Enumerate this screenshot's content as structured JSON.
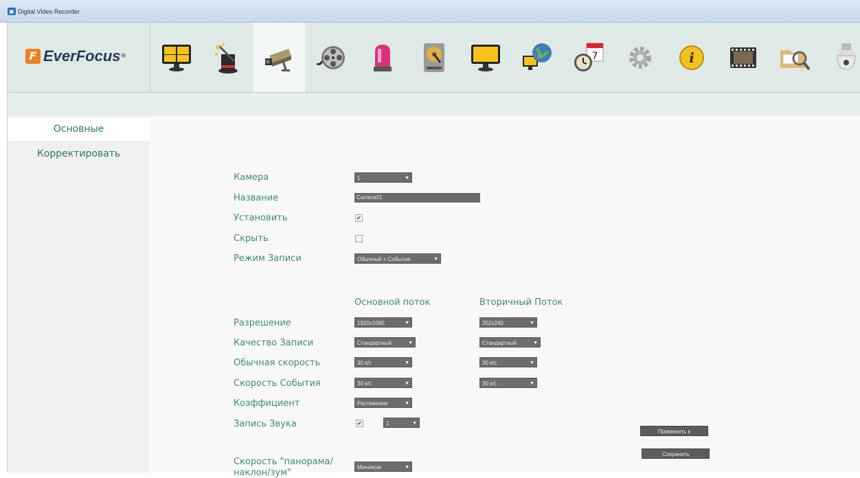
{
  "window": {
    "title": "Digital Video Recorder"
  },
  "brand": {
    "name": "EverFocus",
    "mark": "F",
    "reg": "®"
  },
  "toolbar": {
    "icons": [
      "live-view-monitor-icon",
      "magic-wand-icon",
      "camera-icon",
      "film-reel-icon",
      "alarm-siren-icon",
      "hard-disk-icon",
      "display-monitor-icon",
      "network-globe-icon",
      "schedule-clock-icon",
      "gear-icon",
      "info-icon",
      "film-strip-icon",
      "search-folder-icon",
      "ptz-dome-camera-icon"
    ],
    "active_index": 2
  },
  "sidebar": {
    "items": [
      {
        "label": "Основные",
        "active": true
      },
      {
        "label": "Корректировать",
        "active": false
      }
    ]
  },
  "form": {
    "camera": {
      "label": "Камера",
      "value": "1"
    },
    "name": {
      "label": "Название",
      "value": "Camera01"
    },
    "install": {
      "label": "Установить",
      "checked": true
    },
    "hide": {
      "label": "Скрыть",
      "checked": false
    },
    "record_mode": {
      "label": "Режим Записи",
      "value": "Обычный + События"
    },
    "columns": {
      "main": "Основной поток",
      "secondary": "Вторичный Поток"
    },
    "resolution": {
      "label": "Разрешение",
      "main": "1920x1080",
      "secondary": "352x240"
    },
    "quality": {
      "label": "Качество Записи",
      "main": "Стандартный",
      "secondary": "Стандартный"
    },
    "normal_rate": {
      "label": "Обычная скорость",
      "main": "30 к/с",
      "secondary": "30 к/с"
    },
    "event_rate": {
      "label": "Скорость События",
      "main": "30 к/с",
      "secondary": "30 к/с"
    },
    "ratio": {
      "label": "Коэффициент",
      "value": "Растяжение"
    },
    "audio": {
      "label": "Запись Звука",
      "checked": true,
      "channel": "1"
    },
    "ptz_speed": {
      "label_line1": "Скорость \"панорама/",
      "label_line2": "наклон/зум\"",
      "value": "Минимум"
    }
  },
  "buttons": {
    "apply_to": "Применить к",
    "save": "Сохранить"
  },
  "colors": {
    "accent": "#3f8a78",
    "control": "#6d6d6d",
    "toolbar": "#dfeae6"
  }
}
